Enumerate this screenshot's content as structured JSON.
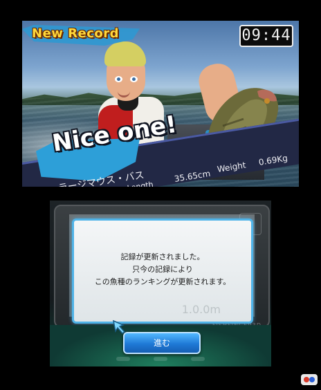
{
  "top_screen": {
    "badge": "New Record",
    "timer": "09:44",
    "catch_message": "Nice one!",
    "catch_info": {
      "species": "ラージマウス・バス",
      "length_label": "Length",
      "length_value": "35.65cm",
      "weight_label": "Weight",
      "weight_value": "0.69Kg"
    }
  },
  "bottom_screen": {
    "brand": "FISHFINGER3D",
    "dialog": {
      "lines": [
        "記録が更新されました。",
        "只今の記録により",
        "この魚種のランキングが更新されます。"
      ],
      "background_reading": "1.0.0m"
    },
    "next_button_label": "進む"
  },
  "colors": {
    "accent_blue": "#2f98d1",
    "badge_yellow": "#ffd93b",
    "button_blue": "#1f79d6",
    "dialog_border": "#4fb3e8"
  },
  "icons": [
    "pointer-arrow-icon",
    "gamer-logo-icon"
  ]
}
